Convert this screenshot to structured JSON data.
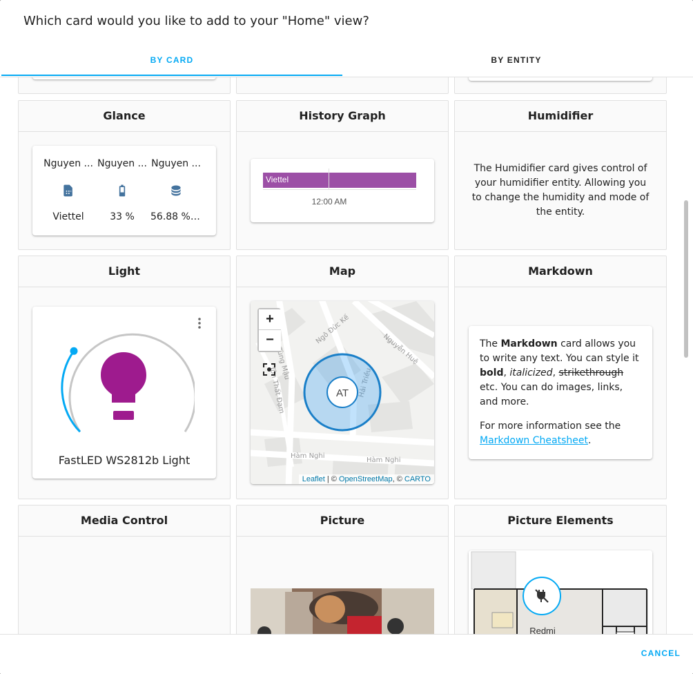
{
  "dialog": {
    "title": "Which card would you like to add to your \"Home\" view?"
  },
  "tabs": [
    {
      "label": "BY CARD",
      "active": true
    },
    {
      "label": "BY ENTITY",
      "active": false
    }
  ],
  "cards": {
    "glance": {
      "title": "Glance",
      "entities": [
        {
          "name": "Nguyen ...",
          "icon": "sim-card-icon",
          "state": "Viettel"
        },
        {
          "name": "Nguyen ...",
          "icon": "battery-icon",
          "state": "33 %"
        },
        {
          "name": "Nguyen ...",
          "icon": "database-icon",
          "state": "56.88 % ..."
        }
      ]
    },
    "history_graph": {
      "title": "History Graph",
      "bar_label": "Viettel",
      "time_label": "12:00 AM",
      "bar_color": "#9c4fa6"
    },
    "humidifier": {
      "title": "Humidifier",
      "description": "The Humidifier card gives control of your humidifier entity. Allowing you to change the humidity and mode of the entity."
    },
    "light": {
      "title": "Light",
      "name": "FastLED WS2812b Light",
      "bulb_color": "#9e1b8e",
      "brightness": 0.25,
      "menu_icon": "dots-vertical-icon"
    },
    "map": {
      "title": "Map",
      "zoom_in": "+",
      "zoom_out": "−",
      "marker": "AT",
      "streets": [
        "Tùng Mậu",
        "Ngô Đức Kế",
        "Nguyễn Huệ",
        "Hải Triều",
        "Tôn Thất Đạm",
        "Hàm Nghi",
        "Hàm Nghi"
      ],
      "attribution": {
        "leaflet": "Leaflet",
        "sep1": " | © ",
        "osm": "OpenStreetMap",
        "sep2": ", © ",
        "carto": "CARTO"
      }
    },
    "markdown": {
      "title": "Markdown",
      "p1_a": "The ",
      "p1_bold1": "Markdown",
      "p1_b": " card allows you to write any text. You can style it ",
      "p1_bold2": "bold",
      "p1_c": ", ",
      "p1_italic": "italicized",
      "p1_d": ", ",
      "p1_strike": "strikethrough",
      "p1_e": " etc. You can do images, links, and more.",
      "p2_a": "For more information see the ",
      "p2_link": "Markdown Cheatsheet",
      "p2_b": "."
    },
    "media_control": {
      "title": "Media Control"
    },
    "picture": {
      "title": "Picture"
    },
    "picture_elements": {
      "title": "Picture Elements",
      "label": "Redmi",
      "icon": "power-plug-off-icon"
    }
  },
  "footer": {
    "cancel": "CANCEL"
  },
  "colors": {
    "accent": "#03a9f4",
    "light": "#9e1b8e"
  }
}
